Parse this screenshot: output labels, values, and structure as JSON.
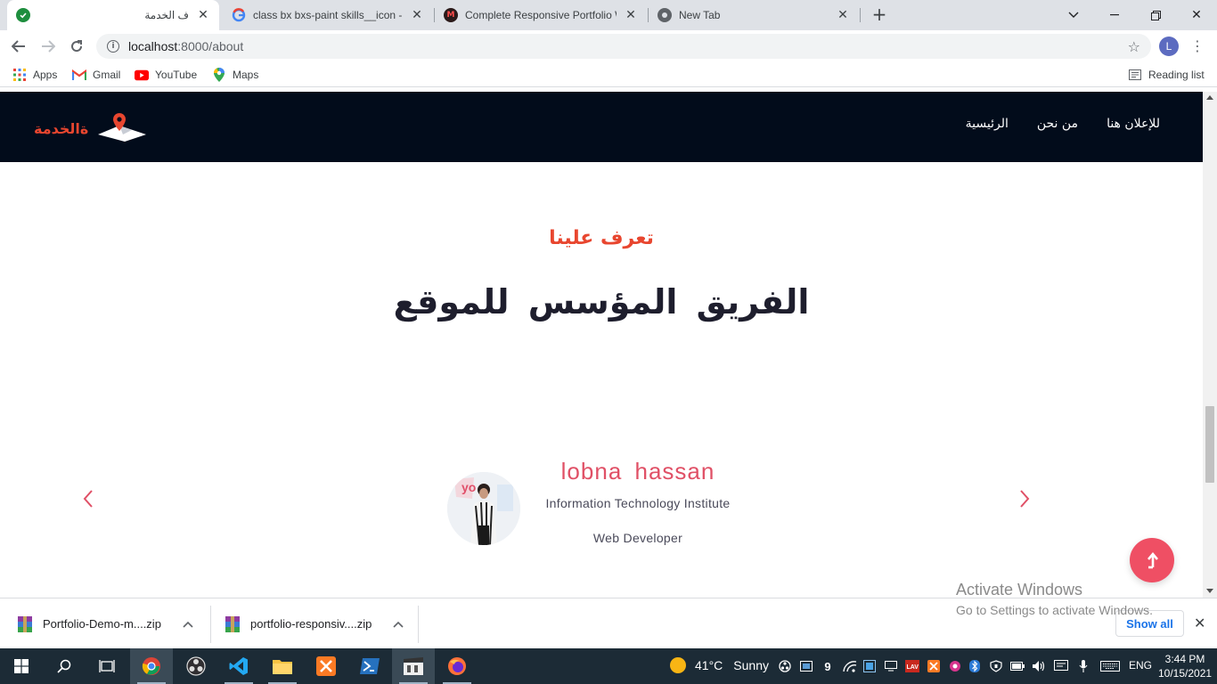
{
  "browser": {
    "tabs": [
      {
        "title": "ف الخدمة",
        "favicon": "check-circle-icon"
      },
      {
        "title": "class bx bxs-paint skills__icon - ت",
        "favicon": "google-g-icon"
      },
      {
        "title": "Complete Responsive Portfolio W",
        "favicon": "m-logo-icon"
      },
      {
        "title": "New Tab",
        "favicon": "chrome-icon"
      }
    ],
    "url_host": "localhost",
    "url_rest": ":8000/about",
    "profile_initial": "L"
  },
  "bookmarks": [
    {
      "label": "Apps",
      "icon": "apps-grid-icon"
    },
    {
      "label": "Gmail",
      "icon": "gmail-icon"
    },
    {
      "label": "YouTube",
      "icon": "youtube-icon"
    },
    {
      "label": "Maps",
      "icon": "maps-pin-icon"
    }
  ],
  "reading_list": "Reading list",
  "site": {
    "logo_text": "ةالخدمة",
    "nav": [
      "للإعلان هنا",
      "من نحن",
      "الرئيسية"
    ],
    "subtitle": "تعرف علينا",
    "heading": "الفريق المؤسس للموقع",
    "member": {
      "name": "lobna hassan",
      "org": "Information Technology Institute",
      "role": "Web Developer"
    },
    "colors": {
      "navbar": "#020c1b",
      "accent": "#e8462f",
      "pink": "#e05066",
      "scroll_button": "#ef4f64"
    }
  },
  "watermark": {
    "line1": "Activate Windows",
    "line2": "Go to Settings to activate Windows."
  },
  "downloads": {
    "items": [
      "Portfolio-Demo-m....zip",
      "portfolio-responsiv....zip"
    ],
    "show_all": "Show all"
  },
  "taskbar": {
    "temperature": "41°C",
    "condition": "Sunny",
    "language": "ENG",
    "time": "3:44 PM",
    "date": "10/15/2021",
    "tray_badge": "9"
  }
}
